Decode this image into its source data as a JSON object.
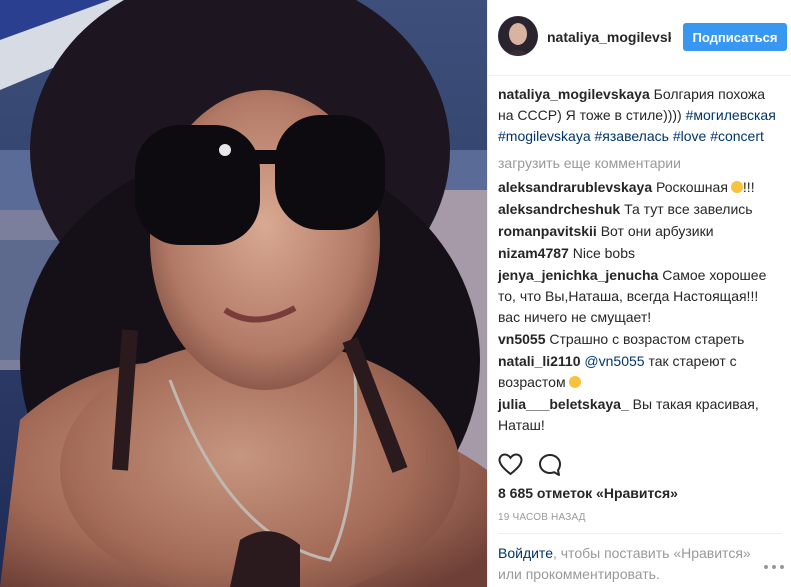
{
  "header": {
    "username": "nataliya_mogilevskaya",
    "follow_label": "Подписаться"
  },
  "caption": {
    "username": "nataliya_mogilevskaya",
    "text": "Болгария похожа на СССР) Я тоже в стиле)))) ",
    "hashtags": [
      "#могилевская",
      "#mogilevskaya",
      "#язавелась",
      "#love",
      "#concert"
    ]
  },
  "load_more": "загрузить еще комментарии",
  "comments": [
    {
      "username": "aleksandrarublevskaya",
      "text": "Роскошная",
      "emoji": "smile-emoji",
      "suffix": "!!!"
    },
    {
      "username": "aleksandrcheshuk",
      "text": "Та тут все завелись"
    },
    {
      "username": "romanpavitskii",
      "text": "Вот они арбузики"
    },
    {
      "username": "nizam4787",
      "text": "Nice bobs"
    },
    {
      "username": "jenya_jenichka_jenucha",
      "text": "Самое хорошее то, что Вы,Наташа, всегда Настоящая!!! вас ничего не смущает!"
    },
    {
      "username": "vn5055",
      "text": "Страшно с возрастом стареть"
    },
    {
      "username": "natali_li2110",
      "mention": "@vn5055",
      "text": "так стареют с возрастом",
      "emoji": "laugh-emoji"
    },
    {
      "username": "julia___beletskaya_",
      "text": "Вы такая красивая, Наташ!"
    }
  ],
  "likes": "8 685 отметок «Нравится»",
  "timestamp": "19 ЧАСОВ НАЗАД",
  "login": {
    "link": "Войдите",
    "text": ", чтобы поставить «Нравится» или прокомментировать."
  },
  "colors": {
    "accent": "#3897f0",
    "link": "#003569",
    "muted": "#999999"
  }
}
